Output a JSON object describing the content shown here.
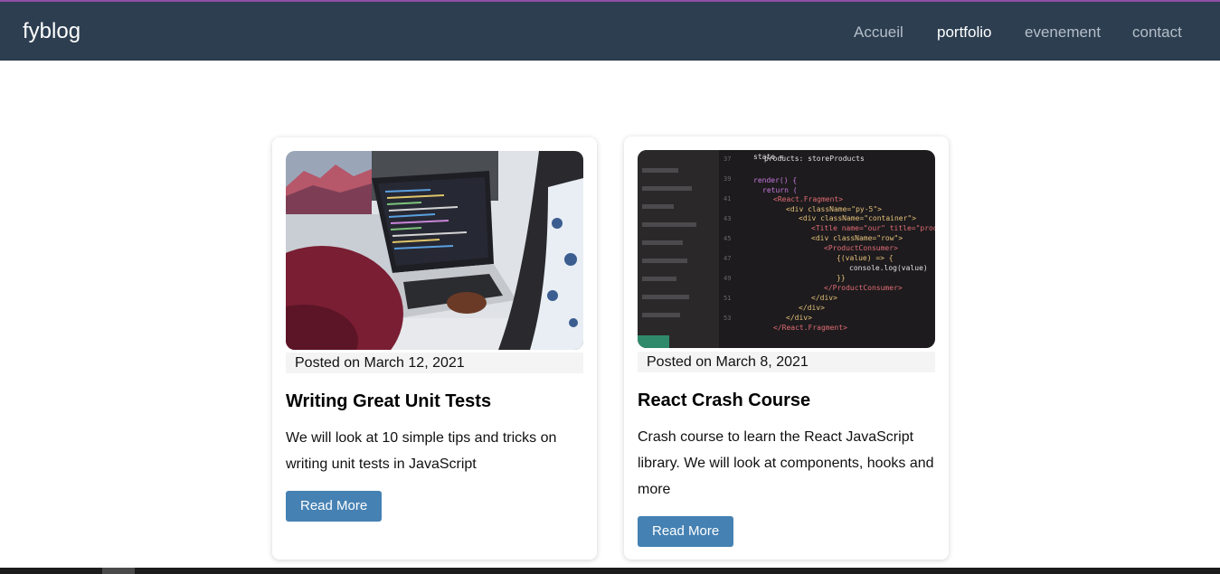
{
  "navbar": {
    "brand": "fyblog",
    "links": [
      {
        "label": "Accueil",
        "active": false
      },
      {
        "label": "portfolio",
        "active": true
      },
      {
        "label": "evenement",
        "active": false
      },
      {
        "label": "contact",
        "active": false
      }
    ]
  },
  "posts": [
    {
      "image": "laptop-coding-photo",
      "date": "Posted on March 12, 2021",
      "title": "Writing Great Unit Tests",
      "excerpt": "We will look at 10 simple tips and tricks on writing unit tests in JavaScript",
      "button": "Read More"
    },
    {
      "image": "react-code-screen-photo",
      "date": "Posted on March 8, 2021",
      "title": "React Crash Course",
      "excerpt": "Crash course to learn the React JavaScript library. We will look at components, hooks and more",
      "button": "Read More"
    }
  ],
  "colors": {
    "navbar": "#2c3e50",
    "accent_stripe": "#8e4fa6",
    "button": "#4581b3"
  }
}
